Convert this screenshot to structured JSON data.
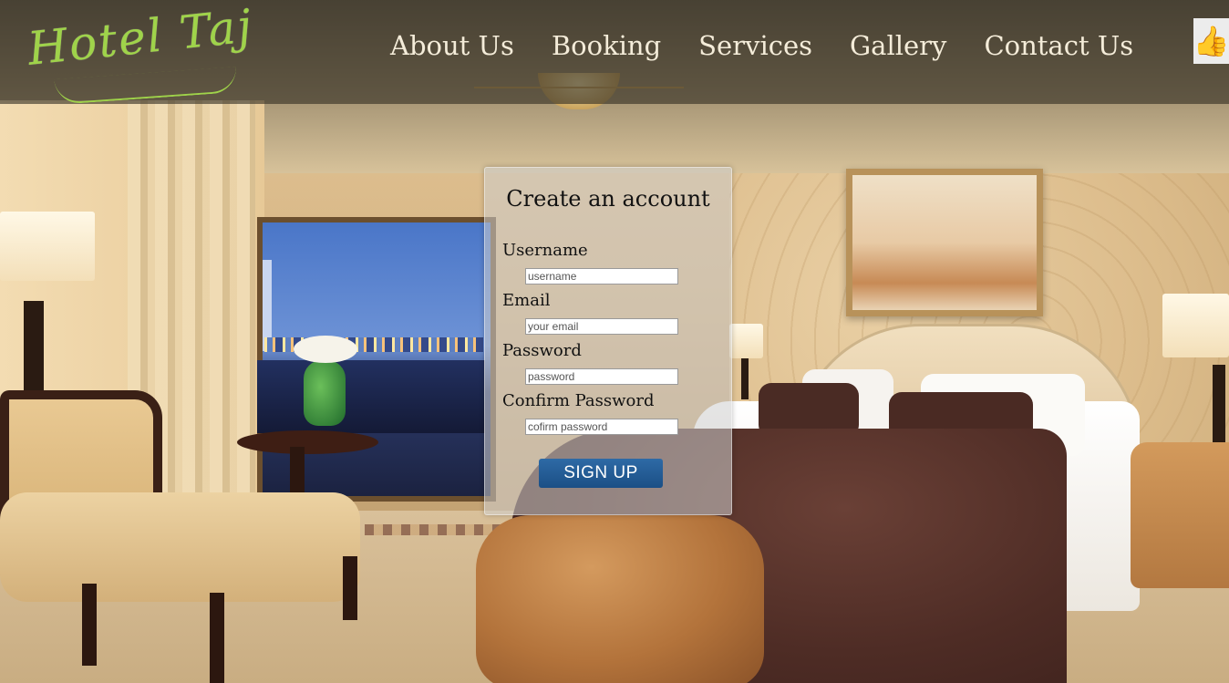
{
  "brand": {
    "logo_text": "Hotel Taj"
  },
  "nav": {
    "items": [
      {
        "label": "About Us"
      },
      {
        "label": "Booking"
      },
      {
        "label": "Services"
      },
      {
        "label": "Gallery"
      },
      {
        "label": "Contact Us"
      }
    ],
    "like_icon": "thumbs-up-icon"
  },
  "signup_form": {
    "title": "Create an account",
    "fields": [
      {
        "label": "Username",
        "placeholder": "username"
      },
      {
        "label": "Email",
        "placeholder": "your email"
      },
      {
        "label": "Password",
        "placeholder": "password"
      },
      {
        "label": "Confirm Password",
        "placeholder": "cofirm password"
      }
    ],
    "submit_label": "SIGN UP"
  },
  "colors": {
    "logo": "#9fd34a",
    "nav_text": "#f4ecd9",
    "button": "#1f5a93"
  }
}
